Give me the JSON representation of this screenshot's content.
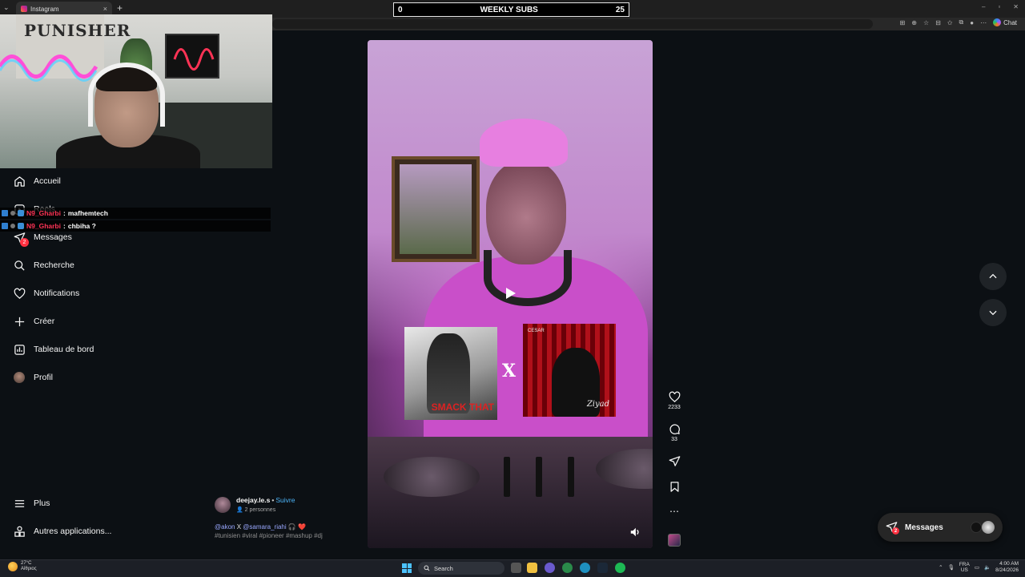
{
  "browser": {
    "tab_title": "Instagram",
    "tab_close": "×",
    "new_tab": "+",
    "chat_label": "Chat"
  },
  "stream_overlay": {
    "subs_start": "0",
    "subs_label": "WEEKLY SUBS",
    "subs_goal": "25"
  },
  "webcam": {
    "poster_text": "PUNISHER"
  },
  "sidebar": {
    "items": [
      {
        "label": "Accueil",
        "icon": "home-icon"
      },
      {
        "label": "Reels",
        "icon": "reels-icon"
      },
      {
        "label": "Messages",
        "icon": "messages-icon",
        "badge": "2"
      },
      {
        "label": "Recherche",
        "icon": "search-icon"
      },
      {
        "label": "Notifications",
        "icon": "heart-icon"
      },
      {
        "label": "Créer",
        "icon": "plus-icon"
      },
      {
        "label": "Tableau de bord",
        "icon": "dashboard-icon"
      },
      {
        "label": "Profil",
        "icon": "avatar"
      }
    ],
    "bottom": [
      {
        "label": "Plus",
        "icon": "menu-icon"
      },
      {
        "label": "Autres applications...",
        "icon": "apps-icon"
      }
    ]
  },
  "chat": [
    {
      "user": "N9_Gharbi",
      "message": "mafhemtech"
    },
    {
      "user": "N9_Gharbi",
      "message": "chbiha ?"
    }
  ],
  "post": {
    "username": "deejay.le.s",
    "separator": "•",
    "follow_label": "Suivre",
    "people": "2 personnes",
    "caption_mention1": "@akon",
    "caption_x": "X",
    "caption_mention2": "@samara_riahi",
    "caption_emoji": "🎧 ❤️",
    "hashtags": "#tunisien #viral #pioneer #mashup #dj"
  },
  "video": {
    "cover_a_text": "SMACK THAT",
    "cover_b_label": "CESAR",
    "cover_b_sig": "Ziyad",
    "x_mark": "X"
  },
  "actions": {
    "likes": "2233",
    "comments": "33"
  },
  "messages_pill": {
    "label": "Messages",
    "badge": "2"
  },
  "taskbar": {
    "temp": "27°C",
    "weather": "Αίθριος",
    "search_placeholder": "Search",
    "lang_top": "FRA",
    "lang_bottom": "US",
    "time": "4:00 AM",
    "date": "8/24/2026"
  },
  "colors": {
    "background": "#0c1014",
    "accent_blue": "#4cb5f9",
    "badge_red": "#ff3040",
    "chat_user": "#ff3355"
  }
}
